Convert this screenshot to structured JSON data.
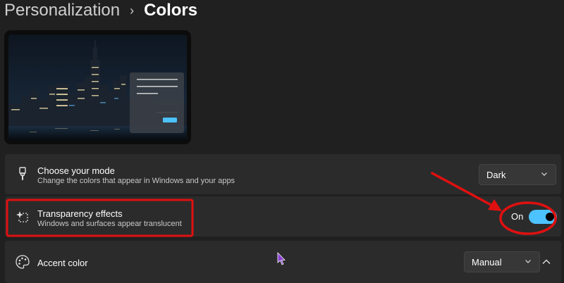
{
  "breadcrumb": {
    "parent": "Personalization",
    "separator": "›",
    "current": "Colors"
  },
  "preview": {
    "image": "city-skyline-night-wallpaper",
    "window_mock": {
      "lines": 3,
      "button": "accent-button"
    }
  },
  "settings": {
    "mode": {
      "icon": "paintbrush-icon",
      "title": "Choose your mode",
      "subtitle": "Change the colors that appear in Windows and your apps",
      "value": "Dark"
    },
    "transparency": {
      "icon": "sparkle-transparency-icon",
      "title": "Transparency effects",
      "subtitle": "Windows and surfaces appear translucent",
      "state_label": "On",
      "enabled": true
    },
    "accent": {
      "icon": "palette-icon",
      "title": "Accent color",
      "value": "Manual",
      "expanded": true
    }
  },
  "colors": {
    "background": "#202020",
    "card": "#2b2b2b",
    "toggle_on": "#4cc2ff",
    "annotation": "#e01010",
    "cursor": "#8a3fd1"
  },
  "annotations": {
    "highlight_box": "transparency-effects-row",
    "highlight_ellipse": "transparency-toggle",
    "arrow": "points-to-toggle"
  }
}
